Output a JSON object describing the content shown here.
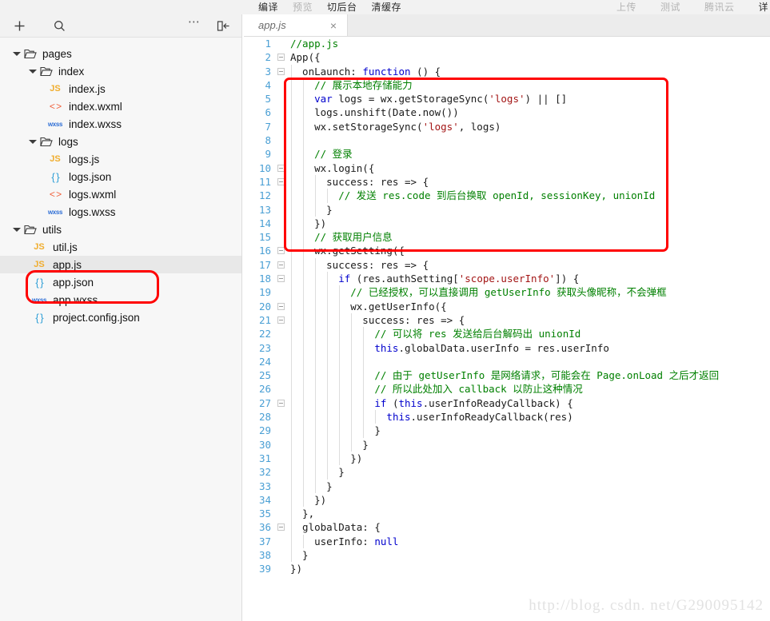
{
  "toolbar": {
    "left_items": [
      {
        "label": "编译",
        "dim": false
      },
      {
        "label": "预览",
        "dim": true
      },
      {
        "label": "切后台",
        "dim": false
      },
      {
        "label": "清缓存",
        "dim": false
      }
    ],
    "right_items": [
      {
        "label": "上传",
        "dim": true
      },
      {
        "label": "测试",
        "dim": true
      },
      {
        "label": "腾讯云",
        "dim": true
      },
      {
        "label": "详",
        "dim": false
      }
    ]
  },
  "sidebar": {
    "header": {
      "add_icon": "plus-icon",
      "search_icon": "search-icon",
      "more_icon": "more-horizontal-icon",
      "collapse_icon": "collapse-sidebar-icon"
    },
    "tree": [
      {
        "type": "folder",
        "label": "pages",
        "depth": 0,
        "expanded": true,
        "icon": "folder-open-icon"
      },
      {
        "type": "folder",
        "label": "index",
        "depth": 1,
        "expanded": true,
        "icon": "folder-open-icon"
      },
      {
        "type": "file",
        "label": "index.js",
        "depth": 2,
        "icon": "js-file-icon",
        "badge": "JS",
        "badge_class": "js"
      },
      {
        "type": "file",
        "label": "index.wxml",
        "depth": 2,
        "icon": "wxml-file-icon",
        "badge": "< >",
        "badge_class": "wxml"
      },
      {
        "type": "file",
        "label": "index.wxss",
        "depth": 2,
        "icon": "wxss-file-icon",
        "badge": "wxss",
        "badge_class": "wxss"
      },
      {
        "type": "folder",
        "label": "logs",
        "depth": 1,
        "expanded": true,
        "icon": "folder-open-icon"
      },
      {
        "type": "file",
        "label": "logs.js",
        "depth": 2,
        "icon": "js-file-icon",
        "badge": "JS",
        "badge_class": "js"
      },
      {
        "type": "file",
        "label": "logs.json",
        "depth": 2,
        "icon": "json-file-icon",
        "badge": "{ }",
        "badge_class": "json"
      },
      {
        "type": "file",
        "label": "logs.wxml",
        "depth": 2,
        "icon": "wxml-file-icon",
        "badge": "< >",
        "badge_class": "wxml"
      },
      {
        "type": "file",
        "label": "logs.wxss",
        "depth": 2,
        "icon": "wxss-file-icon",
        "badge": "wxss",
        "badge_class": "wxss"
      },
      {
        "type": "folder",
        "label": "utils",
        "depth": 0,
        "expanded": true,
        "icon": "folder-open-icon"
      },
      {
        "type": "file",
        "label": "util.js",
        "depth": 1,
        "icon": "js-file-icon",
        "badge": "JS",
        "badge_class": "js"
      },
      {
        "type": "file",
        "label": "app.js",
        "depth": 1,
        "icon": "js-file-icon",
        "badge": "JS",
        "badge_class": "js",
        "selected": true
      },
      {
        "type": "file",
        "label": "app.json",
        "depth": 1,
        "icon": "json-file-icon",
        "badge": "{ }",
        "badge_class": "json"
      },
      {
        "type": "file",
        "label": "app.wxss",
        "depth": 1,
        "icon": "wxss-file-icon",
        "badge": "wxss",
        "badge_class": "wxss"
      },
      {
        "type": "file",
        "label": "project.config.json",
        "depth": 1,
        "icon": "json-file-icon",
        "badge": "{ }",
        "badge_class": "json"
      }
    ]
  },
  "editor": {
    "tab": {
      "title": "app.js",
      "close_label": "×"
    },
    "lines": [
      {
        "n": "1",
        "fold": false,
        "guides": 0,
        "tokens": [
          {
            "t": "//app.js",
            "c": "c"
          }
        ]
      },
      {
        "n": "2",
        "fold": true,
        "guides": 0,
        "tokens": [
          {
            "t": "App({",
            "c": "p"
          }
        ]
      },
      {
        "n": "3",
        "fold": true,
        "guides": 1,
        "tokens": [
          {
            "t": "  onLaunch: ",
            "c": "p"
          },
          {
            "t": "function",
            "c": "k"
          },
          {
            "t": " () {",
            "c": "p"
          }
        ]
      },
      {
        "n": "4",
        "fold": false,
        "guides": 2,
        "tokens": [
          {
            "t": "    // 展示本地存储能力",
            "c": "c"
          }
        ]
      },
      {
        "n": "5",
        "fold": false,
        "guides": 2,
        "tokens": [
          {
            "t": "    ",
            "c": "p"
          },
          {
            "t": "var",
            "c": "k"
          },
          {
            "t": " logs = wx.getStorageSync(",
            "c": "p"
          },
          {
            "t": "'logs'",
            "c": "s"
          },
          {
            "t": ") || []",
            "c": "p"
          }
        ]
      },
      {
        "n": "6",
        "fold": false,
        "guides": 2,
        "tokens": [
          {
            "t": "    logs.unshift(Date.now())",
            "c": "p"
          }
        ]
      },
      {
        "n": "7",
        "fold": false,
        "guides": 2,
        "tokens": [
          {
            "t": "    wx.setStorageSync(",
            "c": "p"
          },
          {
            "t": "'logs'",
            "c": "s"
          },
          {
            "t": ", logs)",
            "c": "p"
          }
        ]
      },
      {
        "n": "8",
        "fold": false,
        "guides": 2,
        "tokens": [
          {
            "t": "",
            "c": "p"
          }
        ]
      },
      {
        "n": "9",
        "fold": false,
        "guides": 2,
        "tokens": [
          {
            "t": "    // 登录",
            "c": "c"
          }
        ]
      },
      {
        "n": "10",
        "fold": true,
        "guides": 2,
        "tokens": [
          {
            "t": "    wx.login({",
            "c": "p"
          }
        ]
      },
      {
        "n": "11",
        "fold": true,
        "guides": 3,
        "tokens": [
          {
            "t": "      success: res => {",
            "c": "p"
          }
        ]
      },
      {
        "n": "12",
        "fold": false,
        "guides": 4,
        "tokens": [
          {
            "t": "        // 发送 res.code 到后台换取 openId, sessionKey, unionId",
            "c": "c"
          }
        ]
      },
      {
        "n": "13",
        "fold": false,
        "guides": 3,
        "tokens": [
          {
            "t": "      }",
            "c": "p"
          }
        ]
      },
      {
        "n": "14",
        "fold": false,
        "guides": 2,
        "tokens": [
          {
            "t": "    })",
            "c": "p"
          }
        ]
      },
      {
        "n": "15",
        "fold": false,
        "guides": 2,
        "tokens": [
          {
            "t": "    // 获取用户信息",
            "c": "c"
          }
        ]
      },
      {
        "n": "16",
        "fold": true,
        "guides": 2,
        "tokens": [
          {
            "t": "    wx.getSetting({",
            "c": "p"
          }
        ]
      },
      {
        "n": "17",
        "fold": true,
        "guides": 3,
        "tokens": [
          {
            "t": "      success: res => {",
            "c": "p"
          }
        ]
      },
      {
        "n": "18",
        "fold": true,
        "guides": 4,
        "tokens": [
          {
            "t": "        ",
            "c": "p"
          },
          {
            "t": "if",
            "c": "k"
          },
          {
            "t": " (res.authSetting[",
            "c": "p"
          },
          {
            "t": "'scope.userInfo'",
            "c": "s"
          },
          {
            "t": "]) {",
            "c": "p"
          }
        ]
      },
      {
        "n": "19",
        "fold": false,
        "guides": 5,
        "tokens": [
          {
            "t": "          // 已经授权，可以直接调用 getUserInfo 获取头像昵称，不会弹框",
            "c": "c"
          }
        ]
      },
      {
        "n": "20",
        "fold": true,
        "guides": 5,
        "tokens": [
          {
            "t": "          wx.getUserInfo({",
            "c": "p"
          }
        ]
      },
      {
        "n": "21",
        "fold": true,
        "guides": 6,
        "tokens": [
          {
            "t": "            success: res => {",
            "c": "p"
          }
        ]
      },
      {
        "n": "22",
        "fold": false,
        "guides": 7,
        "tokens": [
          {
            "t": "              // 可以将 res 发送给后台解码出 unionId",
            "c": "c"
          }
        ]
      },
      {
        "n": "23",
        "fold": false,
        "guides": 7,
        "tokens": [
          {
            "t": "              ",
            "c": "p"
          },
          {
            "t": "this",
            "c": "k"
          },
          {
            "t": ".globalData.userInfo = res.userInfo",
            "c": "p"
          }
        ]
      },
      {
        "n": "24",
        "fold": false,
        "guides": 7,
        "tokens": [
          {
            "t": "",
            "c": "p"
          }
        ]
      },
      {
        "n": "25",
        "fold": false,
        "guides": 7,
        "tokens": [
          {
            "t": "              // 由于 getUserInfo 是网络请求，可能会在 Page.onLoad 之后才返回",
            "c": "c"
          }
        ]
      },
      {
        "n": "26",
        "fold": false,
        "guides": 7,
        "tokens": [
          {
            "t": "              // 所以此处加入 callback 以防止这种情况",
            "c": "c"
          }
        ]
      },
      {
        "n": "27",
        "fold": true,
        "guides": 7,
        "tokens": [
          {
            "t": "              ",
            "c": "p"
          },
          {
            "t": "if",
            "c": "k"
          },
          {
            "t": " (",
            "c": "p"
          },
          {
            "t": "this",
            "c": "k"
          },
          {
            "t": ".userInfoReadyCallback) {",
            "c": "p"
          }
        ]
      },
      {
        "n": "28",
        "fold": false,
        "guides": 8,
        "tokens": [
          {
            "t": "                ",
            "c": "p"
          },
          {
            "t": "this",
            "c": "k"
          },
          {
            "t": ".userInfoReadyCallback(res)",
            "c": "p"
          }
        ]
      },
      {
        "n": "29",
        "fold": false,
        "guides": 7,
        "tokens": [
          {
            "t": "              }",
            "c": "p"
          }
        ]
      },
      {
        "n": "30",
        "fold": false,
        "guides": 6,
        "tokens": [
          {
            "t": "            }",
            "c": "p"
          }
        ]
      },
      {
        "n": "31",
        "fold": false,
        "guides": 5,
        "tokens": [
          {
            "t": "          })",
            "c": "p"
          }
        ]
      },
      {
        "n": "32",
        "fold": false,
        "guides": 4,
        "tokens": [
          {
            "t": "        }",
            "c": "p"
          }
        ]
      },
      {
        "n": "33",
        "fold": false,
        "guides": 3,
        "tokens": [
          {
            "t": "      }",
            "c": "p"
          }
        ]
      },
      {
        "n": "34",
        "fold": false,
        "guides": 2,
        "tokens": [
          {
            "t": "    })",
            "c": "p"
          }
        ]
      },
      {
        "n": "35",
        "fold": false,
        "guides": 1,
        "tokens": [
          {
            "t": "  },",
            "c": "p"
          }
        ]
      },
      {
        "n": "36",
        "fold": true,
        "guides": 1,
        "tokens": [
          {
            "t": "  globalData: {",
            "c": "p"
          }
        ]
      },
      {
        "n": "37",
        "fold": false,
        "guides": 2,
        "tokens": [
          {
            "t": "    userInfo: ",
            "c": "p"
          },
          {
            "t": "null",
            "c": "k"
          }
        ]
      },
      {
        "n": "38",
        "fold": false,
        "guides": 1,
        "tokens": [
          {
            "t": "  }",
            "c": "p"
          }
        ]
      },
      {
        "n": "39",
        "fold": false,
        "guides": 0,
        "tokens": [
          {
            "t": "})",
            "c": "p"
          }
        ]
      }
    ]
  },
  "watermark": {
    "text": "http://blog. csdn. net/G290095142"
  },
  "colors": {
    "highlight_box": "#ff0000",
    "keyword": "#0000cd",
    "string": "#a31515",
    "comment": "#008000",
    "line_number": "#4a9fd4",
    "selected_row": "#e8e8e8"
  }
}
